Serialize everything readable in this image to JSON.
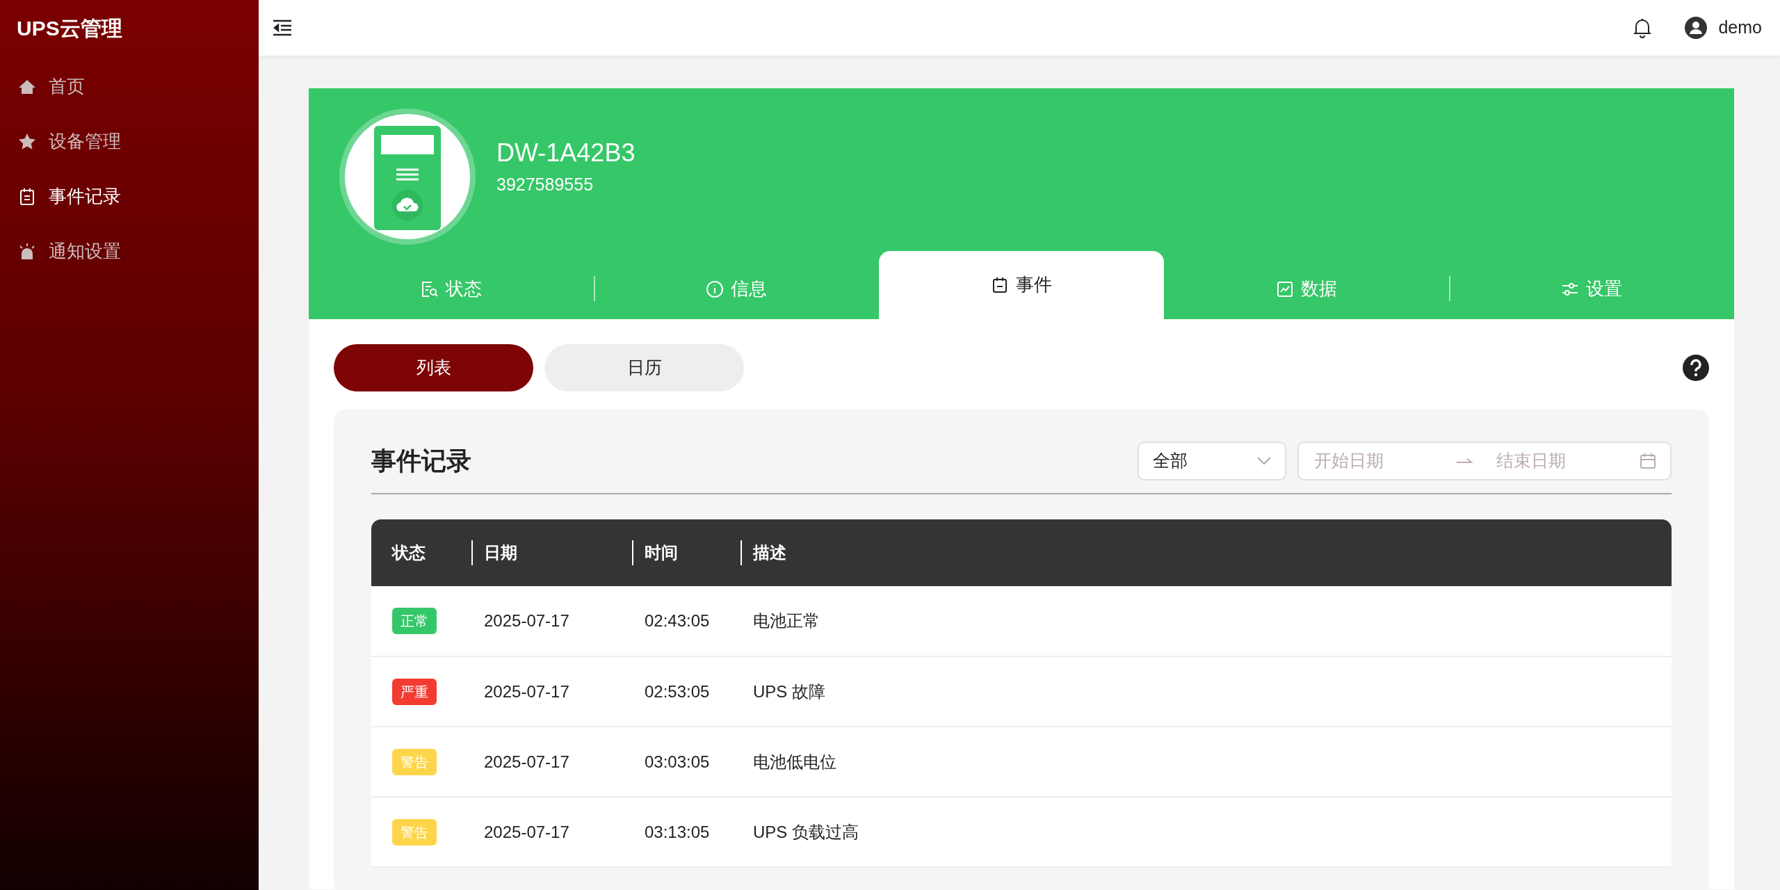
{
  "sidebar": {
    "brand": "UPS云管理",
    "items": [
      {
        "label": "首页",
        "selected": false
      },
      {
        "label": "设备管理",
        "selected": false
      },
      {
        "label": "事件记录",
        "selected": true
      },
      {
        "label": "通知设置",
        "selected": false
      }
    ]
  },
  "header": {
    "user": "demo"
  },
  "device": {
    "name": "DW-1A42B3",
    "serial": "3927589555"
  },
  "tabs": [
    {
      "label": "状态",
      "selected": false
    },
    {
      "label": "信息",
      "selected": false
    },
    {
      "label": "事件",
      "selected": true
    },
    {
      "label": "数据",
      "selected": false
    },
    {
      "label": "设置",
      "selected": false
    }
  ],
  "view_toggle": [
    {
      "label": "列表",
      "selected": true
    },
    {
      "label": "日历",
      "selected": false
    }
  ],
  "events": {
    "title": "事件记录",
    "filter": {
      "value": "全部"
    },
    "date_range": {
      "start_placeholder": "开始日期",
      "end_placeholder": "结束日期"
    },
    "columns": [
      "状态",
      "日期",
      "时间",
      "描述"
    ],
    "rows": [
      {
        "status": "正常",
        "color": "#34c76a",
        "date": "2025-07-17",
        "time": "02:43:05",
        "description": "电池正常"
      },
      {
        "status": "严重",
        "color": "#f23c32",
        "date": "2025-07-17",
        "time": "02:53:05",
        "description": "UPS 故障"
      },
      {
        "status": "警告",
        "color": "#fdd54a",
        "date": "2025-07-17",
        "time": "03:03:05",
        "description": "电池低电位"
      },
      {
        "status": "警告",
        "color": "#fdd54a",
        "date": "2025-07-17",
        "time": "03:13:05",
        "description": "UPS 负载过高"
      }
    ]
  }
}
